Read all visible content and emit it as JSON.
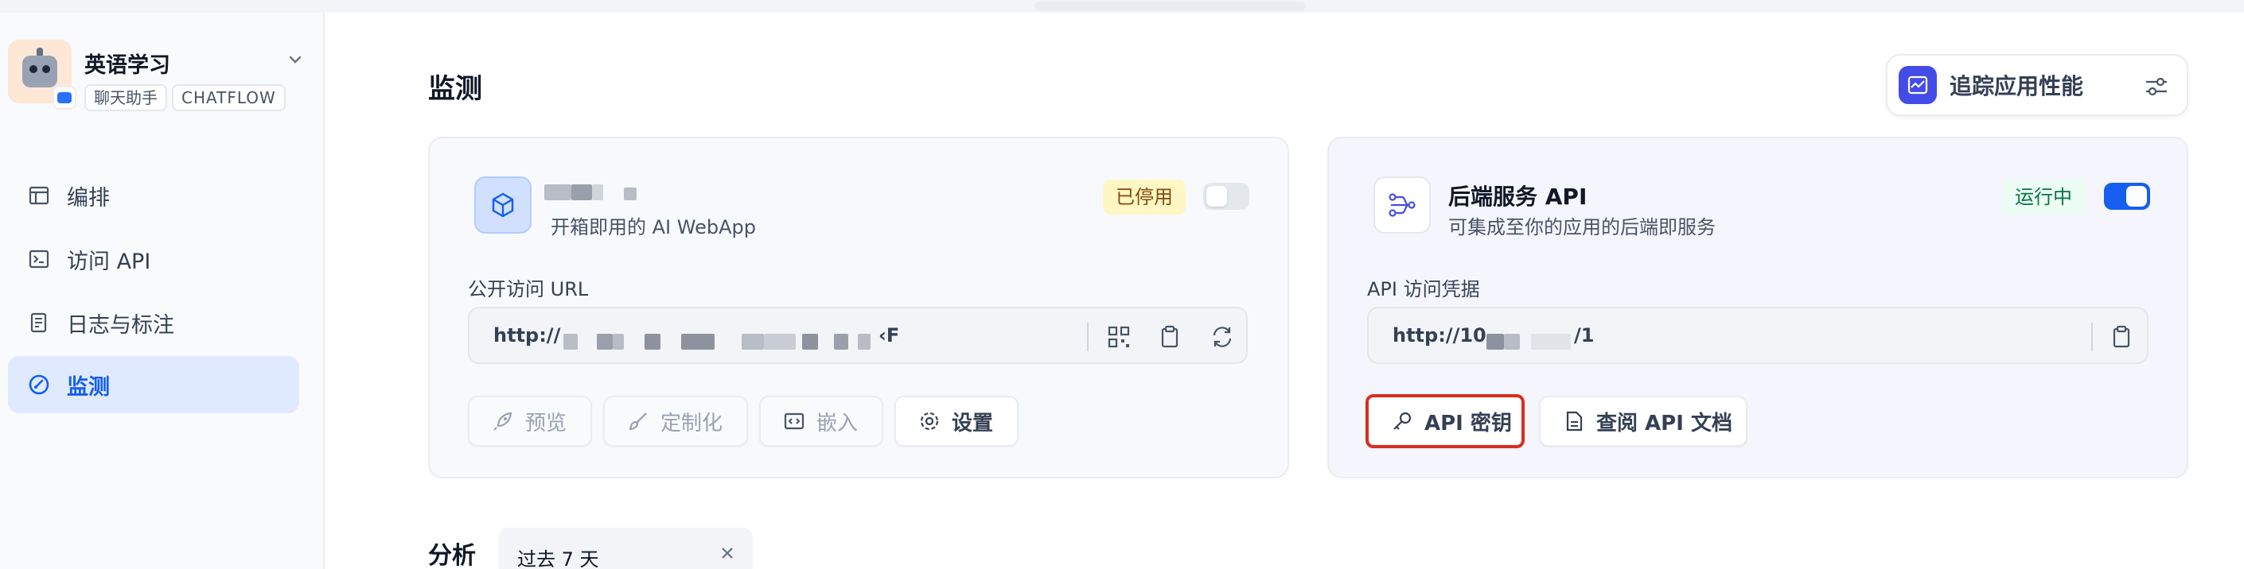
{
  "app": {
    "name": "英语学习",
    "tags": [
      "聊天助手",
      "CHATFLOW"
    ]
  },
  "sidebar": {
    "items": [
      {
        "label": "编排",
        "icon": "layout-icon"
      },
      {
        "label": "访问 API",
        "icon": "terminal-icon"
      },
      {
        "label": "日志与标注",
        "icon": "document-icon"
      },
      {
        "label": "监测",
        "icon": "gauge-icon",
        "active": true
      }
    ]
  },
  "page": {
    "title": "监测",
    "trace_button": "追踪应用性能"
  },
  "webapp_card": {
    "subtitle": "开箱即用的 AI WebApp",
    "status": "已停用",
    "enabled": false,
    "url_label": "公开访问 URL",
    "url_prefix": "http://",
    "url_suffix": "‹F",
    "buttons": {
      "preview": "预览",
      "customize": "定制化",
      "embed": "嵌入",
      "settings": "设置"
    }
  },
  "api_card": {
    "title": "后端服务 API",
    "subtitle": "可集成至你的应用的后端即服务",
    "status": "运行中",
    "enabled": true,
    "credential_label": "API 访问凭据",
    "url_prefix": "http://10.",
    "url_suffix": "/1",
    "buttons": {
      "api_key": "API 密钥",
      "api_docs": "查阅 API 文档"
    }
  },
  "analysis": {
    "label": "分析",
    "period": "过去 7 天"
  },
  "colors": {
    "accent": "#155eef",
    "highlight_border": "#d92d20",
    "disabled_status_bg": "#fef7c3",
    "running_status_bg": "#ecfdf3"
  }
}
